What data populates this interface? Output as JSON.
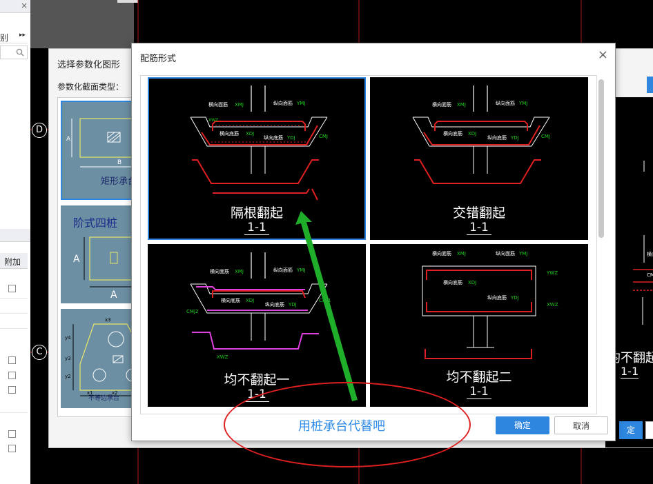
{
  "left_panel": {
    "menu_label": "别",
    "col_label": "附加"
  },
  "cad": {
    "axis_d": "D",
    "axis_c": "C",
    "right_text": "均不翻起一",
    "right_sec": "1-1"
  },
  "back_dialog": {
    "title": "选择参数化图形",
    "section_type_label": "参数化截面类型：",
    "thumb1_label": "矩形承台",
    "thumb2_label": "阶式四桩",
    "thumb3_label": "不等边承台",
    "behind_ok_label": "定"
  },
  "dialog": {
    "title": "配筋形式",
    "close_icon": "×",
    "ok_label": "确定",
    "cancel_label": "取消",
    "options": [
      {
        "name": "隔根翻起",
        "section": "1-1"
      },
      {
        "name": "交错翻起",
        "section": "1-1"
      },
      {
        "name": "均不翻起一",
        "section": "1-1"
      },
      {
        "name": "均不翻起二",
        "section": "1-1"
      }
    ],
    "rebar_labels": {
      "xmj": "横向面筋XMJ",
      "ymj": "纵向面筋YMJ",
      "xdj": "横向底筋XDJ",
      "ydj": "纵向底筋YDJ",
      "cmj": "CMJ",
      "cmj2": "CMJ2",
      "xwz": "XWZ",
      "ywz": "YWZ",
      "cmj1": "CMJ1"
    }
  },
  "annotation": {
    "note": "用桩承台代替吧",
    "arrow_color": "#1fae2a",
    "ellipse_color": "#e02020"
  }
}
